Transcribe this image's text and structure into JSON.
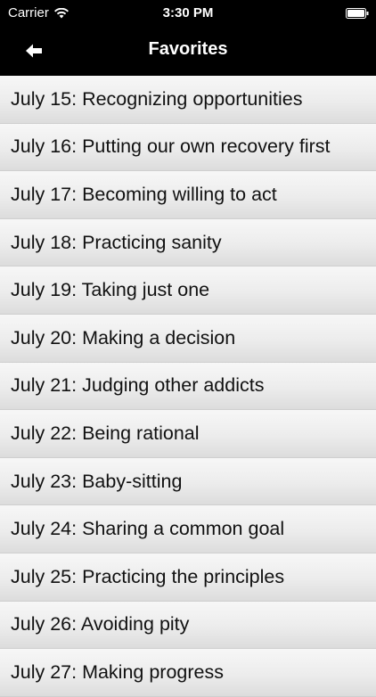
{
  "status_bar": {
    "carrier": "Carrier",
    "time": "3:30 PM",
    "wifi_icon": "wifi-icon",
    "battery_icon": "battery-full-icon"
  },
  "nav": {
    "title": "Favorites",
    "back_icon": "back-arrow-icon",
    "background_color": "#000000",
    "text_color": "#ffffff"
  },
  "favorites": [
    "July 15: Recognizing opportunities",
    "July 16: Putting our own recovery first",
    "July 17: Becoming willing to act",
    "July 18: Practicing sanity",
    "July 19: Taking just one",
    "July 20: Making a decision",
    "July 21: Judging other addicts",
    "July 22: Being rational",
    "July 23: Baby-sitting",
    "July 24: Sharing a common goal",
    "July 25: Practicing the principles",
    "July 26: Avoiding pity",
    "July 27: Making progress"
  ]
}
